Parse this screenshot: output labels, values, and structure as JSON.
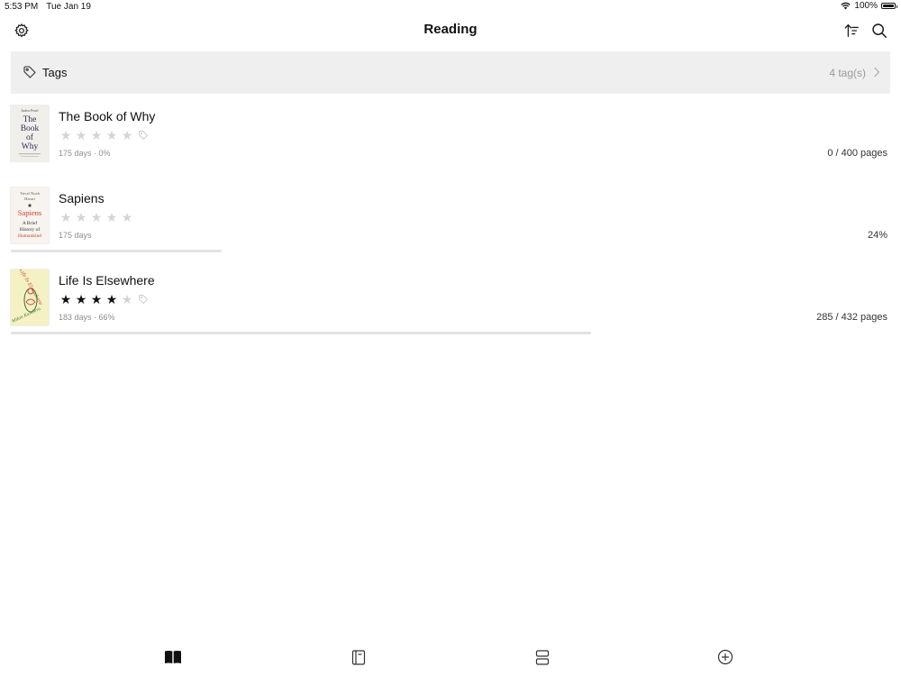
{
  "status_bar": {
    "time": "5:53 PM",
    "date": "Tue Jan 19",
    "battery": "100%"
  },
  "nav": {
    "title": "Reading",
    "left_icon": "gear-icon",
    "right_icons": [
      "sort-icon",
      "search-icon"
    ]
  },
  "tags": {
    "label": "Tags",
    "count": "4 tag(s)"
  },
  "books": [
    {
      "title": "The Book of Why",
      "rating": 0,
      "has_tag_icon": true,
      "meta": "175 days · 0%",
      "progress_text": "0 / 400 pages",
      "progress_fraction": 0,
      "cover_lines": [
        "Judea Pearl",
        "The",
        "Book",
        "of",
        "Why"
      ]
    },
    {
      "title": "Sapiens",
      "rating": 0,
      "has_tag_icon": false,
      "meta": "175 days",
      "progress_text": "24%",
      "progress_fraction": 0.24,
      "cover_lines": [
        "Yuval Noah",
        "Harari",
        "Sapiens",
        "A Brief",
        "History of",
        "Humankind"
      ]
    },
    {
      "title": "Life Is Elsewhere",
      "rating": 4,
      "has_tag_icon": true,
      "meta": "183 days · 66%",
      "progress_text": "285 / 432 pages",
      "progress_fraction": 0.66,
      "cover_lines": [
        "Life Is Elsewhere",
        "Milan Kundera"
      ]
    }
  ],
  "tab_bar": {
    "tabs": [
      "library-icon",
      "notebook-icon",
      "shelves-icon",
      "add-icon"
    ],
    "active": 0
  }
}
